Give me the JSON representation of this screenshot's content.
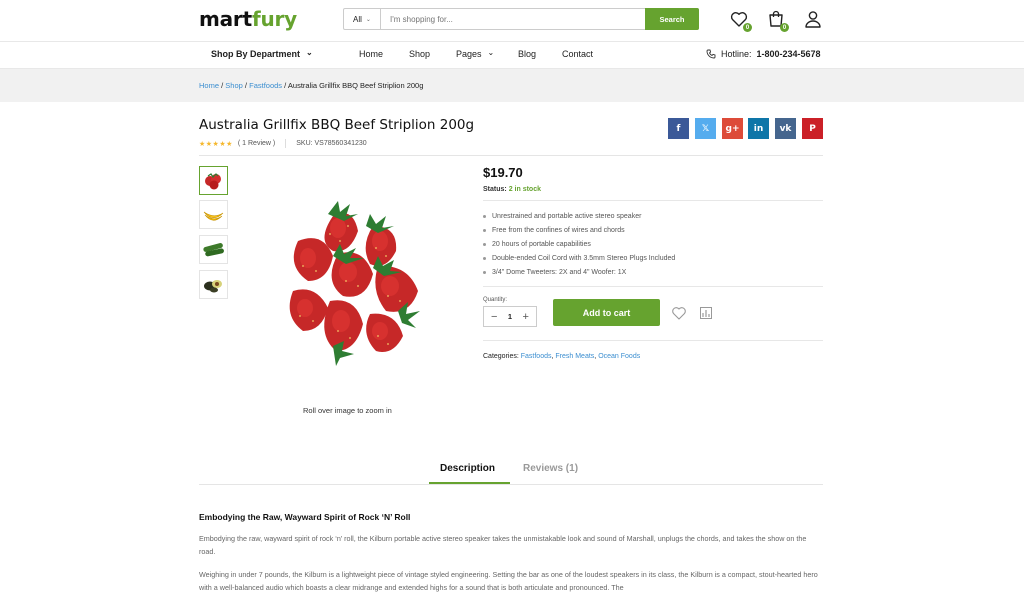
{
  "header": {
    "logo_part1": "mart",
    "logo_part2": "fury",
    "search_category": "All",
    "search_placeholder": "I'm shopping for...",
    "search_button": "Search",
    "wishlist_count": "0",
    "cart_count": "0",
    "accent_color": "#66a32f"
  },
  "nav": {
    "department": "Shop By Department",
    "items": [
      "Home",
      "Shop",
      "Pages",
      "Blog",
      "Contact"
    ],
    "hotline_label": "Hotline:",
    "hotline_number": "1-800-234-5678"
  },
  "breadcrumb": {
    "home": "Home",
    "shop": "Shop",
    "category": "Fastfoods",
    "current": "Australia Grillfix BBQ Beef Striplion 200g",
    "separator": "/"
  },
  "product": {
    "title": "Australia Grillfix BBQ Beef Striplion 200g",
    "stars": "★★★★★",
    "review_count": "( 1 Review )",
    "sku": "SKU: VS78560341230",
    "price": "$19.70",
    "status_label": "Status:",
    "status_value": "2 in stock",
    "features": [
      "Unrestrained and portable active stereo speaker",
      "Free from the confines of wires and chords",
      "20 hours of portable capabilities",
      "Double-ended Coil Cord with 3.5mm Stereo Plugs Included",
      "3/4\" Dome Tweeters: 2X and 4\" Woofer: 1X"
    ],
    "quantity_label": "Quantity:",
    "quantity_value": "1",
    "add_to_cart": "Add to cart",
    "categories_label": "Categories:",
    "categories": [
      "Fastfoods",
      "Fresh Meats",
      "Ocean Foods"
    ],
    "zoom_hint": "Roll over image to zoom in",
    "thumbnails": [
      "strawberry-thumbnail",
      "banana-thumbnail",
      "cucumber-thumbnail",
      "avocado-thumbnail"
    ]
  },
  "social": [
    {
      "icon": "facebook-icon",
      "glyph": "f",
      "color": "#3b5998"
    },
    {
      "icon": "twitter-icon",
      "glyph": "𝕏",
      "color": "#55acee"
    },
    {
      "icon": "google-plus-icon",
      "glyph": "g+",
      "color": "#dd4b39"
    },
    {
      "icon": "linkedin-icon",
      "glyph": "in",
      "color": "#0e76a8"
    },
    {
      "icon": "vk-icon",
      "glyph": "vk",
      "color": "#45668e"
    },
    {
      "icon": "pinterest-icon",
      "glyph": "P",
      "color": "#cb2027"
    }
  ],
  "tabs": {
    "description": "Description",
    "reviews": "Reviews (1)"
  },
  "description": {
    "heading": "Embodying the Raw, Wayward Spirit of Rock ‘N’ Roll",
    "para1": "Embodying the raw, wayward spirit of rock ‘n’ roll, the Kilburn portable active stereo speaker takes the unmistakable look and sound of Marshall, unplugs the chords, and takes the show on the road.",
    "para2": "Weighing in under 7 pounds, the Kilburn is a lightweight piece of vintage styled engineering. Setting the bar as one of the loudest speakers in its class, the Kilburn is a compact, stout-hearted hero with a well-balanced audio which boasts a clear midrange and extended highs for a sound that is both articulate and pronounced. The"
  }
}
